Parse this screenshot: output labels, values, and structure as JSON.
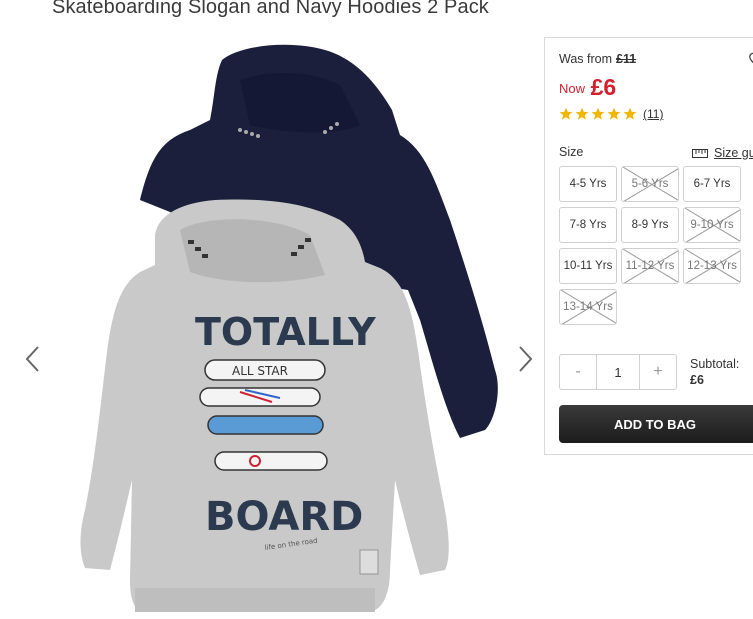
{
  "product": {
    "title": "Skateboarding Slogan and Navy Hoodies 2 Pack",
    "image_alt": "Grey and navy hoodies",
    "print": {
      "line1": "TOTALLY",
      "board_text": "ALL STAR",
      "line2": "BOARD",
      "small_text": "life on the road"
    }
  },
  "pricing": {
    "was_label": "Was from",
    "was_price": "£11",
    "now_label": "Now",
    "now_price": "£6",
    "accent_color": "#d3212c"
  },
  "rating": {
    "stars": 5,
    "max": 5,
    "count_text": "(11)",
    "star_color": "#f2b500"
  },
  "size_section": {
    "label": "Size",
    "guide_label": "Size gu",
    "options": [
      {
        "label": "4-5 Yrs",
        "available": true
      },
      {
        "label": "5-6 Yrs",
        "available": false
      },
      {
        "label": "6-7 Yrs",
        "available": true
      },
      {
        "label": "7-8 Yrs",
        "available": true
      },
      {
        "label": "8-9 Yrs",
        "available": true
      },
      {
        "label": "9-10 Yrs",
        "available": false
      },
      {
        "label": "10-11 Yrs",
        "available": true
      },
      {
        "label": "11-12 Yrs",
        "available": false
      },
      {
        "label": "12-13 Yrs",
        "available": false
      },
      {
        "label": "13-14 Yrs",
        "available": false
      }
    ]
  },
  "quantity": {
    "minus": "-",
    "value": "1",
    "plus": "+"
  },
  "subtotal": {
    "label": "Subtotal:",
    "value": "£6"
  },
  "add_to_bag": "ADD TO BAG",
  "icons": {
    "prev": "chevron-left-icon",
    "next": "chevron-right-icon",
    "wishlist": "heart-icon",
    "ruler": "ruler-icon",
    "star": "star-icon"
  }
}
